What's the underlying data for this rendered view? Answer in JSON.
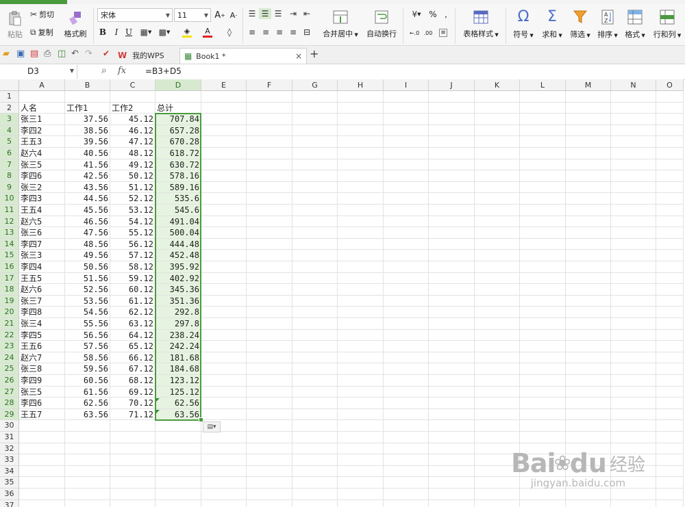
{
  "ribbon": {
    "paste": "粘贴",
    "cut": "剪切",
    "copy": "复制",
    "format_painter": "格式刷",
    "font_name": "宋体",
    "font_size": "11",
    "merge_center": "合并居中",
    "wrap_text": "自动换行",
    "percent": "%",
    "table_style": "表格样式",
    "symbol": "符号",
    "sum": "求和",
    "filter": "筛选",
    "sort": "排序",
    "format": "格式",
    "row_col": "行和列"
  },
  "tabs": {
    "wps": "我的WPS",
    "book": "Book1 *"
  },
  "formula_bar": {
    "name_box": "D3",
    "fx": "fx",
    "formula": "=B3+D5"
  },
  "columns": [
    "A",
    "B",
    "C",
    "D",
    "E",
    "F",
    "G",
    "H",
    "I",
    "J",
    "K",
    "L",
    "M",
    "N",
    "O"
  ],
  "row_numbers": [
    "1",
    "2",
    "3",
    "4",
    "5",
    "6",
    "7",
    "8",
    "9",
    "10",
    "11",
    "12",
    "13",
    "14",
    "15",
    "16",
    "17",
    "18",
    "19",
    "20",
    "21",
    "22",
    "23",
    "24",
    "25",
    "26",
    "27",
    "28",
    "29",
    "30",
    "31",
    "32",
    "33",
    "34",
    "35",
    "36",
    "37"
  ],
  "headers": [
    "人名",
    "工作1",
    "工作2",
    "总计"
  ],
  "rows": [
    [
      "张三1",
      "37.56",
      "45.12",
      "707.84"
    ],
    [
      "李四2",
      "38.56",
      "46.12",
      "657.28"
    ],
    [
      "王五3",
      "39.56",
      "47.12",
      "670.28"
    ],
    [
      "赵六4",
      "40.56",
      "48.12",
      "618.72"
    ],
    [
      "张三5",
      "41.56",
      "49.12",
      "630.72"
    ],
    [
      "李四6",
      "42.56",
      "50.12",
      "578.16"
    ],
    [
      "张三2",
      "43.56",
      "51.12",
      "589.16"
    ],
    [
      "李四3",
      "44.56",
      "52.12",
      "535.6"
    ],
    [
      "王五4",
      "45.56",
      "53.12",
      "545.6"
    ],
    [
      "赵六5",
      "46.56",
      "54.12",
      "491.04"
    ],
    [
      "张三6",
      "47.56",
      "55.12",
      "500.04"
    ],
    [
      "李四7",
      "48.56",
      "56.12",
      "444.48"
    ],
    [
      "张三3",
      "49.56",
      "57.12",
      "452.48"
    ],
    [
      "李四4",
      "50.56",
      "58.12",
      "395.92"
    ],
    [
      "王五5",
      "51.56",
      "59.12",
      "402.92"
    ],
    [
      "赵六6",
      "52.56",
      "60.12",
      "345.36"
    ],
    [
      "张三7",
      "53.56",
      "61.12",
      "351.36"
    ],
    [
      "李四8",
      "54.56",
      "62.12",
      "292.8"
    ],
    [
      "张三4",
      "55.56",
      "63.12",
      "297.8"
    ],
    [
      "李四5",
      "56.56",
      "64.12",
      "238.24"
    ],
    [
      "王五6",
      "57.56",
      "65.12",
      "242.24"
    ],
    [
      "赵六7",
      "58.56",
      "66.12",
      "181.68"
    ],
    [
      "张三8",
      "59.56",
      "67.12",
      "184.68"
    ],
    [
      "李四9",
      "60.56",
      "68.12",
      "123.12"
    ],
    [
      "张三5",
      "61.56",
      "69.12",
      "125.12"
    ],
    [
      "李四6",
      "62.56",
      "70.12",
      "62.56"
    ],
    [
      "王五7",
      "63.56",
      "71.12",
      "63.56"
    ]
  ],
  "watermark": {
    "brand": "Bai",
    "brand2": "du",
    "cn": "经验",
    "url": "jingyan.baidu.com"
  },
  "colors": {
    "accent": "#4a9a3e",
    "selection_fill": "#e6f3e0"
  }
}
